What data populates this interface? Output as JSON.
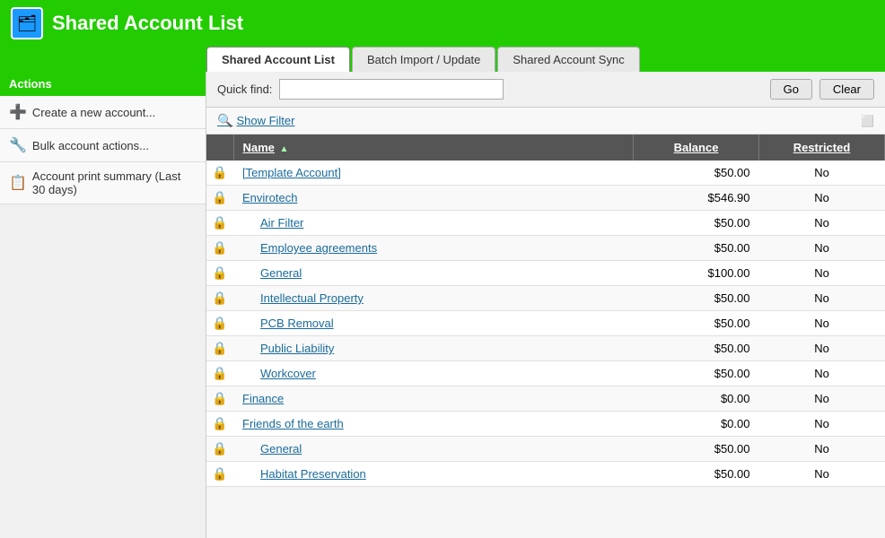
{
  "header": {
    "title": "Shared Account List",
    "icon": "🗂"
  },
  "tabs": [
    {
      "id": "shared-account-list",
      "label": "Shared Account List",
      "active": true
    },
    {
      "id": "batch-import",
      "label": "Batch Import / Update",
      "active": false
    },
    {
      "id": "shared-account-sync",
      "label": "Shared Account Sync",
      "active": false
    }
  ],
  "sidebar": {
    "title": "Actions",
    "items": [
      {
        "id": "create-account",
        "label": "Create a new account...",
        "icon": "➕",
        "icon_class": "sidebar-icon-add"
      },
      {
        "id": "bulk-actions",
        "label": "Bulk account actions...",
        "icon": "🔧",
        "icon_class": "sidebar-icon-bulk"
      },
      {
        "id": "print-summary",
        "label": "Account print summary (Last 30 days)",
        "icon": "📋",
        "icon_class": "sidebar-icon-print"
      }
    ]
  },
  "quickfind": {
    "label": "Quick find:",
    "placeholder": "",
    "go_label": "Go",
    "clear_label": "Clear"
  },
  "filter": {
    "show_filter_label": "Show Filter"
  },
  "table": {
    "columns": [
      {
        "id": "icon",
        "label": ""
      },
      {
        "id": "name",
        "label": "Name",
        "sortable": true,
        "sort_dir": "asc"
      },
      {
        "id": "balance",
        "label": "Balance",
        "sortable": true
      },
      {
        "id": "restricted",
        "label": "Restricted",
        "sortable": true
      }
    ],
    "rows": [
      {
        "id": 1,
        "name": "[Template Account]",
        "balance": "$50.00",
        "restricted": "No",
        "indent": false,
        "lock": "🔒"
      },
      {
        "id": 2,
        "name": "Envirotech",
        "balance": "$546.90",
        "restricted": "No",
        "indent": false,
        "lock": "🔒"
      },
      {
        "id": 3,
        "name": "Air Filter",
        "balance": "$50.00",
        "restricted": "No",
        "indent": true,
        "lock": "🔒"
      },
      {
        "id": 4,
        "name": "Employee agreements",
        "balance": "$50.00",
        "restricted": "No",
        "indent": true,
        "lock": "🔒"
      },
      {
        "id": 5,
        "name": "General",
        "balance": "$100.00",
        "restricted": "No",
        "indent": true,
        "lock": "🔒"
      },
      {
        "id": 6,
        "name": "Intellectual Property",
        "balance": "$50.00",
        "restricted": "No",
        "indent": true,
        "lock": "🔒"
      },
      {
        "id": 7,
        "name": "PCB Removal",
        "balance": "$50.00",
        "restricted": "No",
        "indent": true,
        "lock": "🔒"
      },
      {
        "id": 8,
        "name": "Public Liability",
        "balance": "$50.00",
        "restricted": "No",
        "indent": true,
        "lock": "🔒"
      },
      {
        "id": 9,
        "name": "Workcover",
        "balance": "$50.00",
        "restricted": "No",
        "indent": true,
        "lock": "🔒"
      },
      {
        "id": 10,
        "name": "Finance",
        "balance": "$0.00",
        "restricted": "No",
        "indent": false,
        "lock": "🔒"
      },
      {
        "id": 11,
        "name": "Friends of the earth",
        "balance": "$0.00",
        "restricted": "No",
        "indent": false,
        "lock": "🔒"
      },
      {
        "id": 12,
        "name": "General",
        "balance": "$50.00",
        "restricted": "No",
        "indent": true,
        "lock": "🔒"
      },
      {
        "id": 13,
        "name": "Habitat Preservation",
        "balance": "$50.00",
        "restricted": "No",
        "indent": true,
        "lock": "🔒"
      }
    ]
  },
  "colors": {
    "header_bg": "#22cc00",
    "header_text": "#ffffff",
    "sidebar_title_bg": "#22cc00",
    "tab_active_bg": "#ffffff",
    "table_header_bg": "#555555"
  }
}
